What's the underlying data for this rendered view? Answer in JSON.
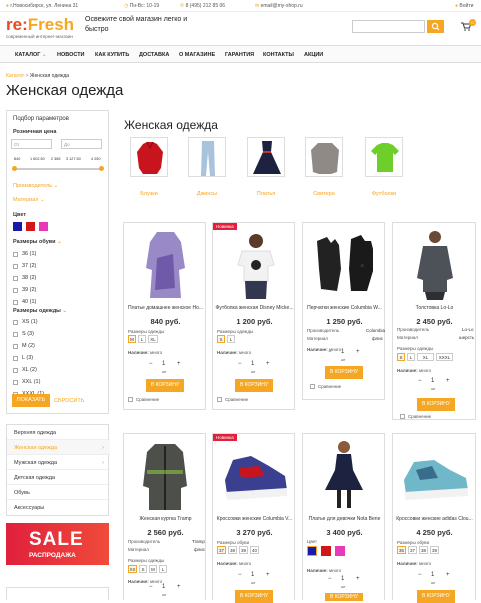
{
  "topbar": {
    "address": "г.Новосибирск, ул. Ленина 31",
    "hours": "Пн-Вс: 10-19",
    "phone": "8 (495) 212 85 06",
    "email": "email@my-shop.ru",
    "login": "Войти"
  },
  "header": {
    "logo_a": "re:",
    "logo_b": "Fresh",
    "logo_sub": "современный интернет-магазин",
    "tagline": "Освежите свой магазин легко и быстро",
    "cart_count": "0"
  },
  "nav": [
    "КАТАЛОГ",
    "НОВОСТИ",
    "КАК КУПИТЬ",
    "ДОСТАВКА",
    "О МАГАЗИНЕ",
    "ГАРАНТИЯ",
    "КОНТАКТЫ",
    "АКЦИИ"
  ],
  "breadcrumb": {
    "root": "Каталог",
    "sep": ">",
    "current": "Женская одежда"
  },
  "page_title": "Женская одежда",
  "filter": {
    "title": "Подбор параметров",
    "price_label": "Розничная цена",
    "from_ph": "От",
    "to_ph": "До",
    "scale": [
      "840",
      "1 602.50",
      "2 365",
      "3 127.50",
      "4 250"
    ],
    "maker": "Производитель",
    "material": "Материал",
    "color": "Цвет",
    "colors": [
      "#1a1aa8",
      "#d01818",
      "#e83ab8"
    ],
    "shoe_sizes_label": "Размеры обуви",
    "shoe_sizes": [
      "36 (1)",
      "37 (2)",
      "38 (2)",
      "39 (2)",
      "40 (1)"
    ],
    "clothes_sizes_label": "Размеры одежды",
    "clothes_sizes": [
      "XS (1)",
      "S (3)",
      "M (2)",
      "L (3)",
      "XL (2)",
      "XXL (1)",
      "XXXL (1)"
    ],
    "show": "ПОКАЗАТЬ",
    "reset": "СБРОСИТЬ"
  },
  "categories": [
    "Верхняя одежда",
    "Женская одежда",
    "Мужская одежда",
    "Детская одежда",
    "Обувь",
    "Аксессуары"
  ],
  "sale": {
    "big": "SALE",
    "small": "РАСПРОДАЖА"
  },
  "section_title": "Женская одежда",
  "subcategories": [
    "Блузки",
    "Джинсы",
    "Платья",
    "Свитера",
    "Футболки"
  ],
  "products": {
    "p1": {
      "name": "Платье домашнее женское Ho...",
      "price": "840 руб.",
      "sizes_label": "Размеры одежды",
      "sizes": [
        "M",
        "L",
        "XL"
      ],
      "stock": "Наличие:",
      "stock_val": "много",
      "qty": "1",
      "unit": "шт",
      "cart": "В КОРЗИНУ",
      "compare": "Сравнение"
    },
    "p2": {
      "badge": "Новинка",
      "name": "Футболка женская Disney Micke...",
      "price": "1 200 руб.",
      "sizes_label": "Размеры одежды",
      "sizes": [
        "S",
        "L"
      ],
      "stock": "Наличие:",
      "stock_val": "много",
      "qty": "1",
      "unit": "шт",
      "cart": "В КОРЗИНУ",
      "compare": "Сравнение"
    },
    "p3": {
      "name": "Перчатки женские Columbia W...",
      "price": "1 250 руб.",
      "maker_label": "Производитель",
      "maker_val": "Columbia",
      "mat_label": "Материал",
      "mat_val": "флис",
      "stock": "Наличие:",
      "stock_val": "много",
      "qty": "1",
      "unit": "шт",
      "cart": "В КОРЗИНУ",
      "compare": "Сравнение"
    },
    "p4": {
      "name": "Толстовка Lo-Lo",
      "price": "2 450 руб.",
      "maker_label": "Производитель",
      "maker_val": "Lo-Lo",
      "mat_label": "Материал",
      "mat_val": "шерсть",
      "sizes_label": "Размеры одежды",
      "sizes": [
        "S",
        "L",
        "XL",
        "XXXL"
      ],
      "stock": "Наличие:",
      "stock_val": "много",
      "qty": "1",
      "unit": "шт",
      "cart": "В КОРЗИНУ",
      "compare": "Сравнение"
    },
    "p5": {
      "name": "Женская куртка Tramp",
      "price": "2 560 руб.",
      "maker_label": "Производитель",
      "maker_val": "Tramp",
      "mat_label": "Материал",
      "mat_val": "флис",
      "sizes_label": "Размеры одежды",
      "sizes": [
        "XS",
        "S",
        "M",
        "L"
      ],
      "stock": "Наличие:",
      "stock_val": "много",
      "qty": "1",
      "unit": "шт",
      "cart": "В КОРЗИНУ"
    },
    "p6": {
      "badge": "Новинка",
      "name": "Кроссовки женские Columbia V...",
      "price": "3 270 руб.",
      "sizes_label": "Размеры обуви",
      "sizes": [
        "37",
        "38",
        "39",
        "40"
      ],
      "stock": "Наличие:",
      "stock_val": "много",
      "qty": "1",
      "unit": "шт",
      "cart": "В КОРЗИНУ"
    },
    "p7": {
      "name": "Платье для девочки Nota Bene",
      "price": "3 400 руб.",
      "color_label": "Цвет",
      "colors": [
        "#1a1aa8",
        "#d01818",
        "#e83ab8"
      ],
      "stock": "Наличие:",
      "stock_val": "много",
      "qty": "1",
      "unit": "шт",
      "cart": "В КОРЗИНУ"
    },
    "p8": {
      "name": "Кроссовки женские adidas Clou...",
      "price": "4 250 руб.",
      "sizes_label": "Размеры обуви",
      "sizes": [
        "36",
        "37",
        "38",
        "39"
      ],
      "stock": "Наличие:",
      "stock_val": "много",
      "qty": "1",
      "unit": "шт",
      "cart": "В КОРЗИНУ"
    }
  }
}
